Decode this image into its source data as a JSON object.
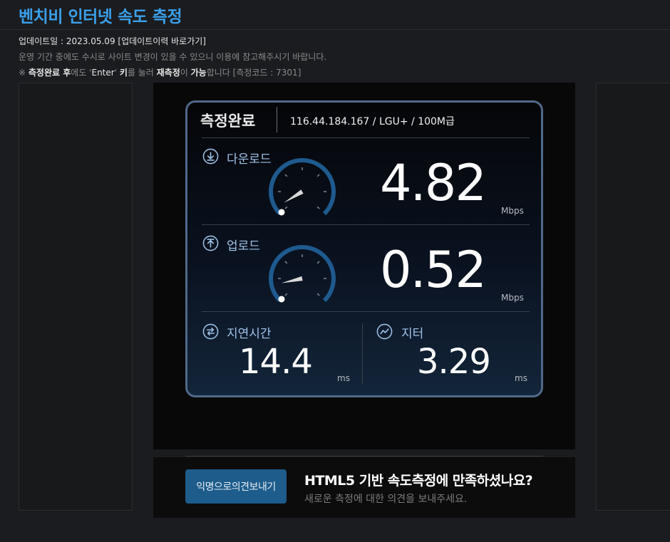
{
  "page": {
    "title": "벤치비 인터넷 속도 측정",
    "update_line": "업데이트일 : 2023.05.09 [업데이트이력 바로가기]",
    "notice_line": "운영 기간 중에도 수시로 사이트 변경이 있을 수 있으니 이용에 참고해주시기 바랍니다.",
    "hint": {
      "mark": "※",
      "part1": "측정완료 후",
      "part2": "에도 '",
      "part3": "Enter",
      "part4": "' ",
      "part5": "키",
      "part6": "를 눌러 ",
      "part7": "재측정",
      "part8": "이 ",
      "part9": "가능",
      "part10": "합니다 [측정코드 : 7301]"
    }
  },
  "result": {
    "status": "측정완료",
    "isp": "116.44.184.167 / LGU+ / 100M급",
    "download": {
      "label": "다운로드",
      "value": "4.82",
      "unit": "Mbps",
      "gauge_fraction": 0.05
    },
    "upload": {
      "label": "업로드",
      "value": "0.52",
      "unit": "Mbps",
      "gauge_fraction": 0.12
    },
    "latency": {
      "label": "지연시간",
      "value": "14.4",
      "unit": "ms"
    },
    "jitter": {
      "label": "지터",
      "value": "3.29",
      "unit": "ms"
    }
  },
  "feedback": {
    "button": "익명으로의견보내기",
    "question": "HTML5 기반 속도측정에 만족하셨나요?",
    "sub": "새로운 측정에 대한 의견을 보내주세요."
  },
  "colors": {
    "accent": "#3aa0ea",
    "gauge_arc": "#1e5a8e",
    "card_border": "#50698a",
    "button": "#1d5c8b"
  }
}
